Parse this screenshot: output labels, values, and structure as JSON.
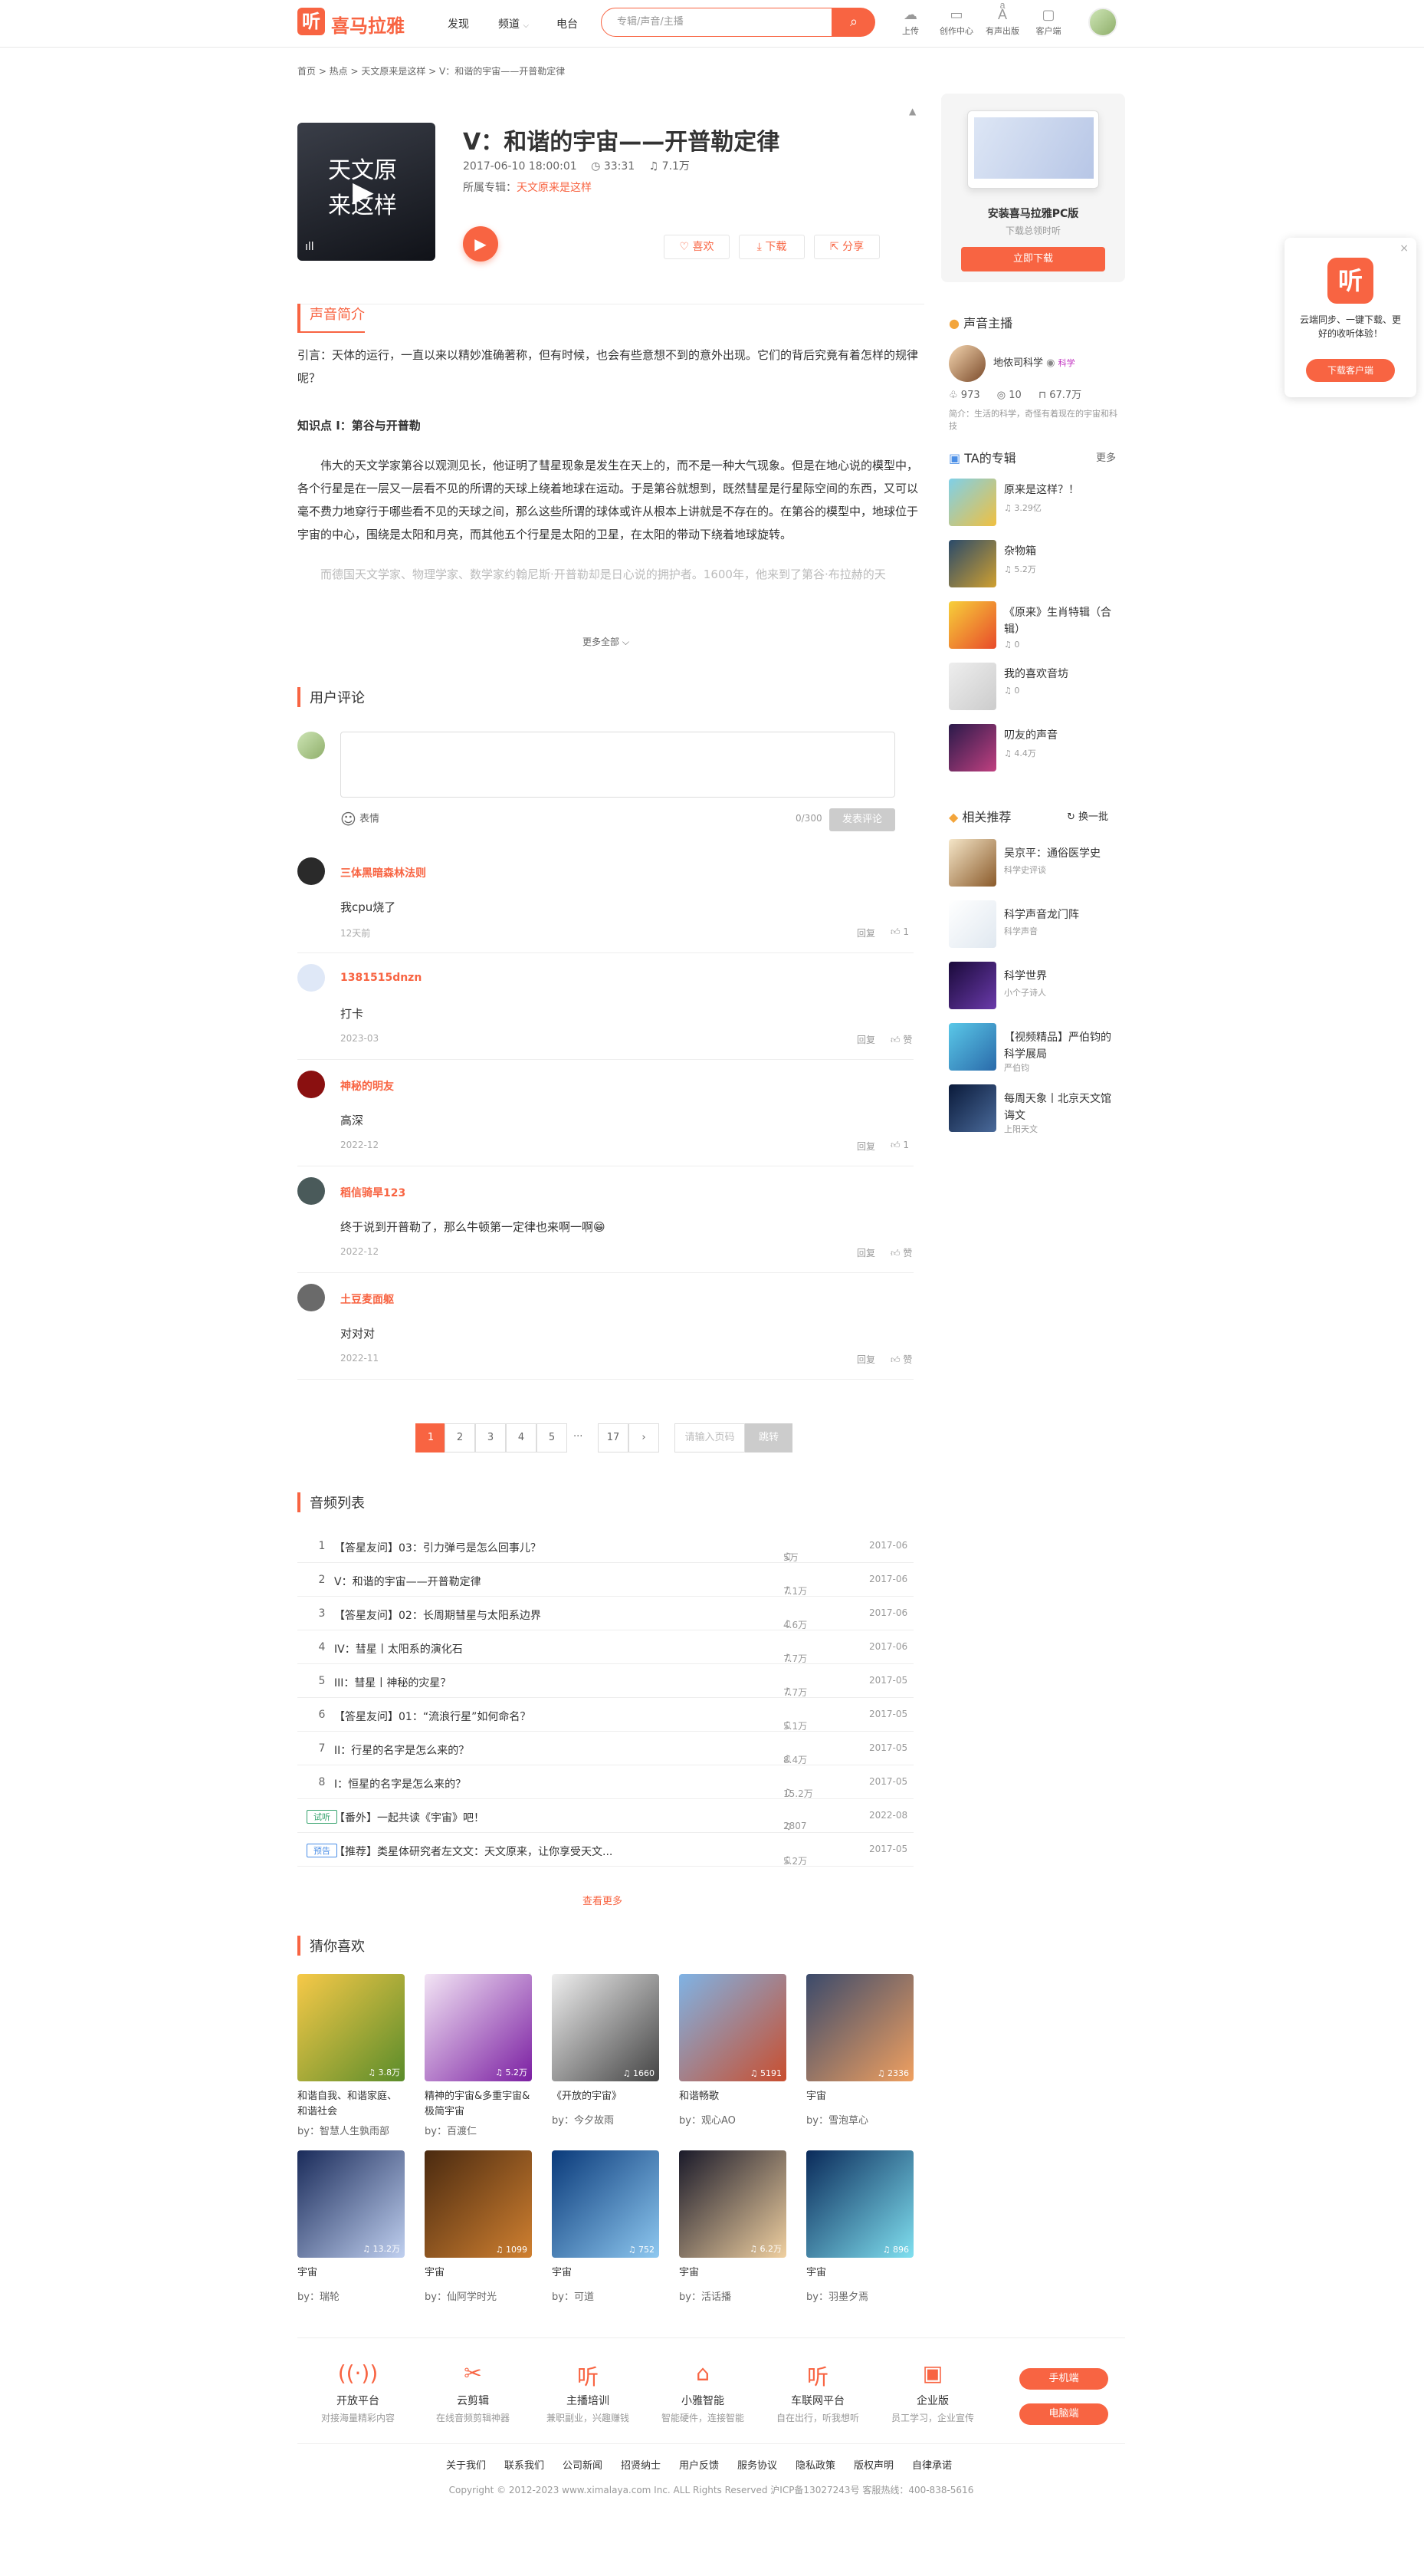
{
  "header": {
    "logo_icon": "听",
    "logo_text": "喜马拉雅",
    "nav": [
      "发现",
      "频道",
      "电台"
    ],
    "search_placeholder": "专辑/声音/主播",
    "tools": [
      {
        "label": "上传",
        "icon": "upload-icon"
      },
      {
        "label": "创作中心",
        "icon": "studio-icon"
      },
      {
        "label": "有声出版",
        "icon": "publish-icon"
      },
      {
        "label": "客户端",
        "icon": "client-icon"
      }
    ]
  },
  "breadcrumb": "首页 > 热点 > 天文原来是这样 > V：和谐的宇宙——开普勒定律",
  "track": {
    "cover_text": "天文原来这样",
    "title": "V：和谐的宇宙——开普勒定律",
    "date": "2017-06-10 18:00:01",
    "duration": "33:31",
    "plays": "7.1万",
    "album_label": "所属专辑：",
    "album_name": "天文原来是这样",
    "like": "喜欢",
    "download": "下载",
    "share": "分享"
  },
  "intro": {
    "heading": "声音简介",
    "p1": "引言：天体的运行，一直以来以精妙准确著称，但有时候，也会有些意想不到的意外出现。它们的背后究竟有着怎样的规律呢？",
    "p2": "知识点 I：第谷与开普勒",
    "p3": "伟大的天文学家第谷以观测见长，他证明了彗星现象是发生在天上的，而不是一种大气现象。但是在地心说的模型中，各个行星是在一层又一层看不见的所谓的天球上绕着地球在运动。于是第谷就想到，既然彗星是行星际空间的东西，又可以毫不费力地穿行于哪些看不见的天球之间，那么这些所谓的球体或许从根本上讲就是不存在的。在第谷的模型中，地球位于宇宙的中心，围绕是太阳和月亮，而其他五个行星是太阳的卫星，在太阳的带动下绕着地球旋转。",
    "p4": "而德国天文学家、物理学家、数学家约翰尼斯·开普勒却是日心说的拥护者。1600年，他来到了第谷·布拉赫的天",
    "more": "更多全部"
  },
  "comments": {
    "heading": "用户评论",
    "emoji": "表情",
    "count": "0/300",
    "submit": "发表评论",
    "reply": "回复",
    "like": "赞",
    "items": [
      {
        "name": "三体黑暗森林法则",
        "text": "我cpu烧了",
        "time": "12天前",
        "likes": "1"
      },
      {
        "name": "1381515dnzn",
        "text": "打卡",
        "time": "2023-03",
        "likes": "赞"
      },
      {
        "name": "神秘的明友",
        "text": "高深",
        "time": "2022-12",
        "likes": "1"
      },
      {
        "name": "稻信骑旱123",
        "text": "终于说到开普勒了，那么牛顿第一定律也来啊一啊😁",
        "time": "2022-12",
        "likes": "赞"
      },
      {
        "name": "土豆麦面躯",
        "text": "对对对",
        "time": "2022-11",
        "likes": "赞"
      }
    ]
  },
  "pagination": {
    "pages": [
      "1",
      "2",
      "3",
      "4",
      "5",
      "17"
    ],
    "ellipsis": "···",
    "next": "›",
    "jump_placeholder": "请输入页码",
    "jump": "跳转"
  },
  "tracklist": {
    "heading": "音频列表",
    "more": "查看更多",
    "rows": [
      {
        "no": "1",
        "title": "【答星友问】03：引力弹弓是怎么回事儿？",
        "plays": "5万",
        "date": "2017-06"
      },
      {
        "no": "2",
        "title": "V：和谐的宇宙——开普勒定律",
        "plays": "7.1万",
        "date": "2017-06"
      },
      {
        "no": "3",
        "title": "【答星友问】02：长周期彗星与太阳系边界",
        "plays": "4.6万",
        "date": "2017-06"
      },
      {
        "no": "4",
        "title": "IV：彗星丨太阳系的演化石",
        "plays": "7.7万",
        "date": "2017-06"
      },
      {
        "no": "5",
        "title": "III：彗星丨神秘的灾星？",
        "plays": "7.7万",
        "date": "2017-05"
      },
      {
        "no": "6",
        "title": "【答星友问】01：“流浪行星”如何命名？",
        "plays": "5.1万",
        "date": "2017-05"
      },
      {
        "no": "7",
        "title": "II：行星的名字是怎么来的？",
        "plays": "8.4万",
        "date": "2017-05"
      },
      {
        "no": "8",
        "title": "I：恒星的名字是怎么来的？",
        "plays": "15.2万",
        "date": "2017-05"
      },
      {
        "no": "试听",
        "title": "【番外】一起共读《宇宙》吧！",
        "plays": "2807",
        "date": "2022-08"
      },
      {
        "no": "预告",
        "title": "【推荐】类星体研究者左文文：天文原来，让你享受天文...",
        "plays": "5.2万",
        "date": "2017-05"
      }
    ]
  },
  "guess": {
    "heading": "猜你喜欢",
    "items": [
      {
        "title": "和谐自我、和谐家庭、和谐社会",
        "by": "by：智慧人生孰雨部",
        "count": "3.8万"
      },
      {
        "title": "精神的宇宙&多重宇宙&极简宇宙",
        "by": "by：百渡仁",
        "count": "5.2万"
      },
      {
        "title": "《开放的宇宙》",
        "by": "by：今夕故雨",
        "count": "1660"
      },
      {
        "title": "和谐畅歌",
        "by": "by：观心AO",
        "count": "5191"
      },
      {
        "title": "宇宙",
        "by": "by：雪泡草心",
        "count": "2336"
      },
      {
        "title": "宇宙",
        "by": "by：瑞轮",
        "count": "13.2万"
      },
      {
        "title": "宇宙",
        "by": "by：仙阿学时光",
        "count": "1099"
      },
      {
        "title": "宇宙",
        "by": "by：可道",
        "count": "752"
      },
      {
        "title": "宇宙",
        "by": "by：活话播",
        "count": "6.2万"
      },
      {
        "title": "宇宙",
        "by": "by：羽墨夕焉",
        "count": "896"
      }
    ]
  },
  "side": {
    "promo": {
      "title": "安装喜马拉雅PC版",
      "sub": "下载总领时听",
      "btn": "立即下载"
    },
    "anchor": {
      "heading": "声音主播",
      "name": "地侬司科学",
      "badge": "科学",
      "fans": "973",
      "albums": "10",
      "plays": "67.7万",
      "desc": "简介：生活的科学，奇怪有着现在的宇宙和科技"
    },
    "albums": {
      "heading": "TA的专辑",
      "more": "更多",
      "items": [
        {
          "name": "原来是这样？！",
          "plays": "3.29亿"
        },
        {
          "name": "杂物箱",
          "plays": "5.2万"
        },
        {
          "name": "《原来》生肖特辑（合辑）",
          "plays": "0"
        },
        {
          "name": "我的喜欢音坊",
          "plays": "0"
        },
        {
          "name": "叨友的声音",
          "plays": "4.4万"
        }
      ]
    },
    "related": {
      "heading": "相关推荐",
      "refresh": "换一批",
      "items": [
        {
          "name": "吴京平：通俗医学史",
          "sub": "科学史评谈"
        },
        {
          "name": "科学声音龙门阵",
          "sub": "科学声音"
        },
        {
          "name": "科学世界",
          "sub": "小个子诗人"
        },
        {
          "name": "【视频精品】严伯钧的科学展局",
          "sub": "严伯钧"
        },
        {
          "name": "每周天象丨北京天文馆诲文",
          "sub": "上阳天文"
        }
      ]
    }
  },
  "float_ad": {
    "icon": "听",
    "text": "云端同步、一键下载、更好的收听体验！",
    "btn": "下载客户端"
  },
  "footer": {
    "items": [
      {
        "name": "开放平台",
        "desc": "对接海量精彩内容"
      },
      {
        "name": "云剪辑",
        "desc": "在线音频剪辑神器"
      },
      {
        "name": "主播培训",
        "desc": "兼职副业，兴趣赚钱"
      },
      {
        "name": "小雅智能",
        "desc": "智能硬件，连接智能"
      },
      {
        "name": "车联网平台",
        "desc": "自在出行，听我想听"
      },
      {
        "name": "企业版",
        "desc": "员工学习，企业宣传"
      }
    ],
    "app_btn": "手机端",
    "pc_btn": "电脑端",
    "links": [
      "关于我们",
      "联系我们",
      "公司新闻",
      "招贤纳士",
      "用户反馈",
      "服务协议",
      "隐私政策",
      "版权声明",
      "自律承诺"
    ],
    "copyright": "Copyright © 2012-2023 www.ximalaya.com Inc. ALL Rights Reserved 沪ICP备13027243号  客服热线：400-838-5616"
  }
}
